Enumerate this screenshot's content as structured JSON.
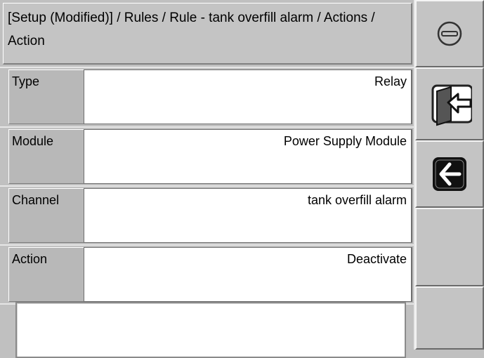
{
  "breadcrumb": "[Setup (Modified)] / Rules / Rule - tank overfill alarm / Actions / Action",
  "fields": [
    {
      "label": "Type",
      "value": "Relay"
    },
    {
      "label": "Module",
      "value": "Power Supply Module"
    },
    {
      "label": "Channel",
      "value": "tank overfill alarm"
    },
    {
      "label": "Action",
      "value": "Deactivate"
    }
  ],
  "side_buttons": [
    {
      "icon": "minus-circle-icon"
    },
    {
      "icon": "exit-door-icon"
    },
    {
      "icon": "back-arrow-icon"
    },
    {
      "icon": ""
    },
    {
      "icon": ""
    }
  ],
  "colors": {
    "background": "#c0c0c0",
    "field_bg": "#ffffff",
    "label_bg": "#b8b8b8"
  }
}
